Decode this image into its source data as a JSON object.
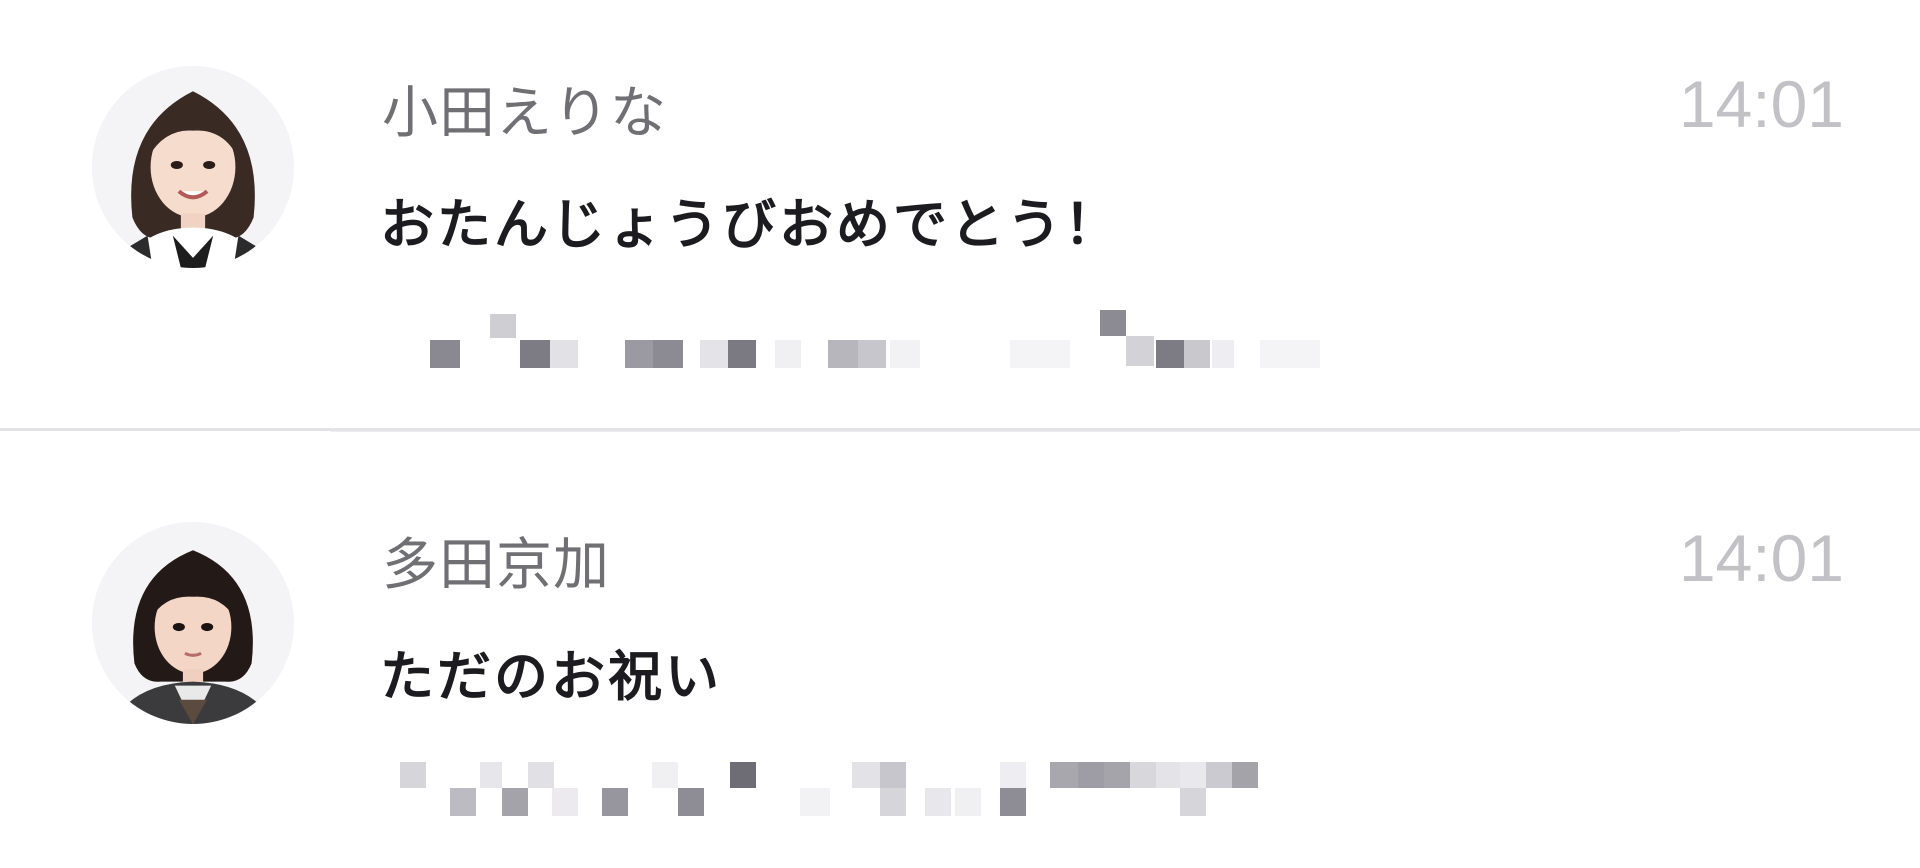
{
  "messages": [
    {
      "sender": "小田えりな",
      "time": "14:01",
      "text": "おたんじょうびおめでとう！",
      "avatar_icon": "member-photo-avatar",
      "preview_state": "pixelated-blurred"
    },
    {
      "sender": "多田京加",
      "time": "14:01",
      "text": "ただのお祝い",
      "avatar_icon": "member-photo-avatar",
      "preview_state": "pixelated-blurred"
    }
  ],
  "colors": {
    "background": "#ffffff",
    "sender_name": "#6f6f74",
    "timestamp": "#c2c2c6",
    "message_text": "#1c1c20",
    "divider": "#e3e3e6"
  }
}
